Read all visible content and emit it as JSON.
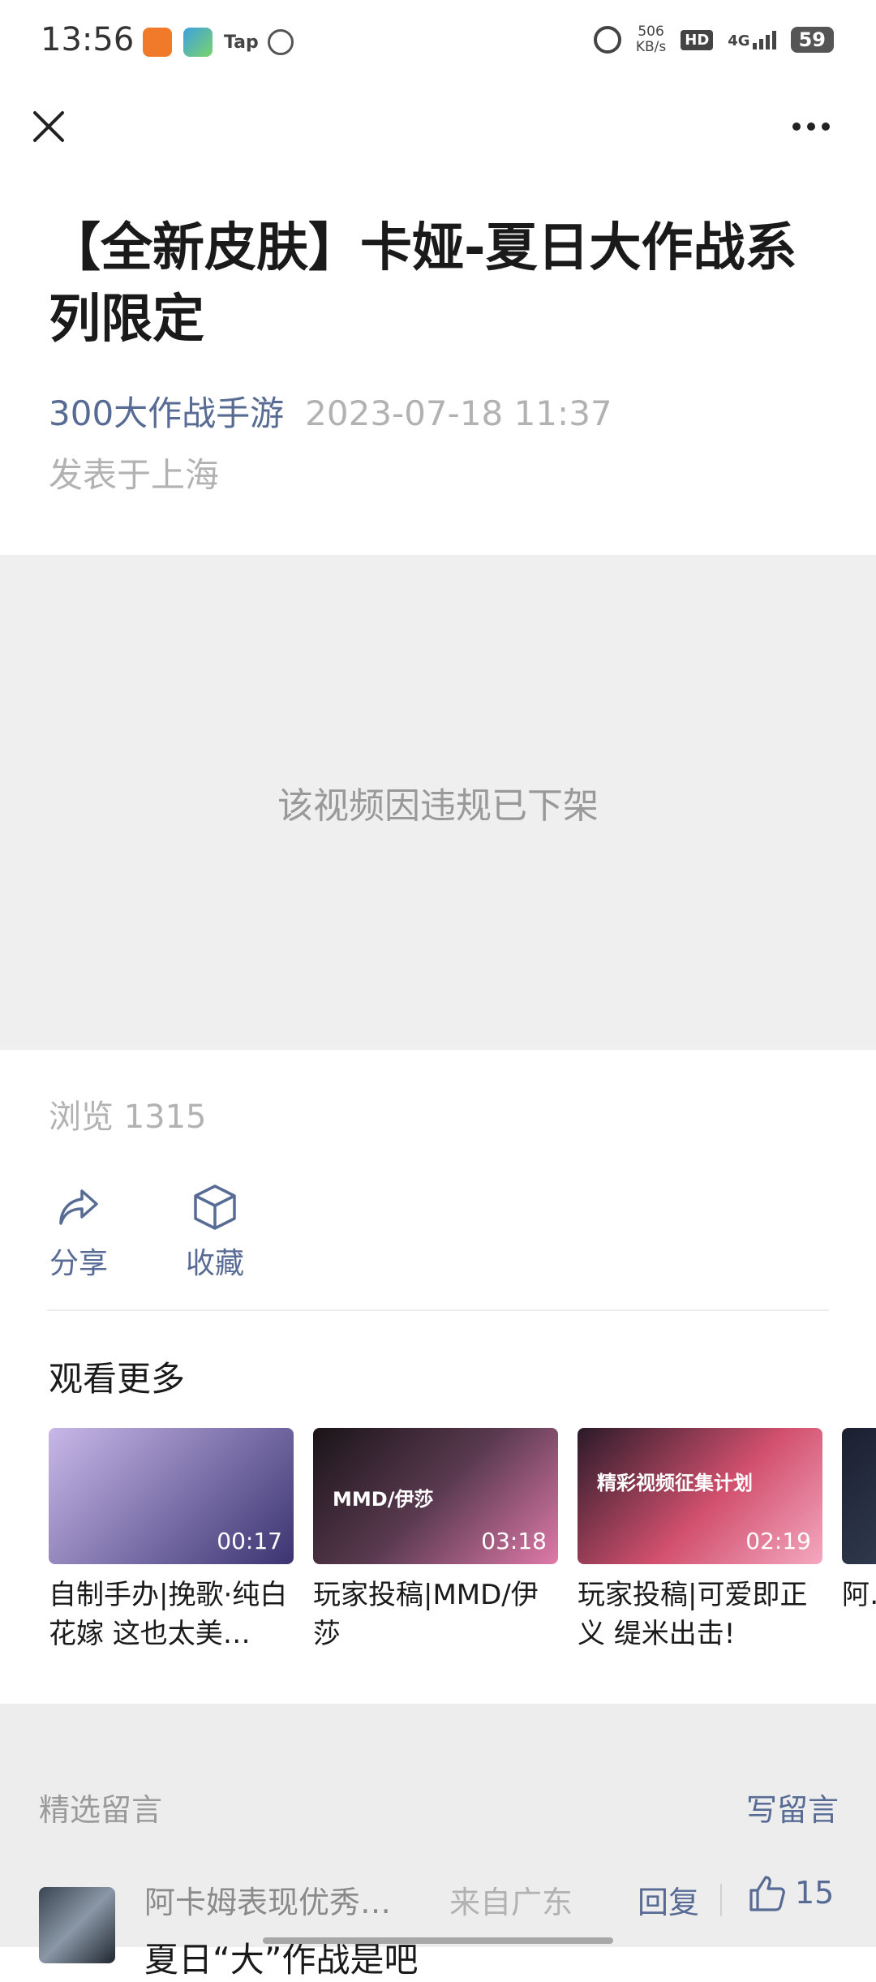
{
  "status_bar": {
    "time": "13:56",
    "app_tap_label": "Tap",
    "net_speed_value": "506",
    "net_speed_unit": "KB/s",
    "hd_label": "HD",
    "signal_label": "4G",
    "battery": "59"
  },
  "icons": {
    "close": "close-icon",
    "more": "more-icon",
    "share": "share-icon",
    "favorite": "cube-icon",
    "like": "thumbs-up-icon"
  },
  "article": {
    "title": "【全新皮肤】卡娅-夏日大作战系列限定",
    "author": "300大作战手游",
    "date": "2023-07-18 11:37",
    "location": "发表于上海"
  },
  "video": {
    "message": "该视频因违规已下架"
  },
  "stats": {
    "views": "浏览 1315"
  },
  "actions": {
    "share": "分享",
    "favorite": "收藏"
  },
  "watch_more": {
    "title": "观看更多",
    "cards": [
      {
        "title": "自制手办|挽歌·纯白花嫁 这也太美…",
        "duration": "00:17",
        "thumb_label": "",
        "color": "#7a6fa8"
      },
      {
        "title": "玩家投稿|MMD/伊莎",
        "duration": "03:18",
        "thumb_label": "MMD/伊莎",
        "color": "#3a2a3a"
      },
      {
        "title": "玩家投稿|可爱即正义 缇米出击!",
        "duration": "02:19",
        "thumb_label": "精彩视频征集计划",
        "color": "#d1506e"
      },
      {
        "title": "阿…我…",
        "duration": "",
        "thumb_label": "",
        "color": "#2a3040"
      }
    ]
  },
  "comments": {
    "header": "精选留言",
    "write": "写留言",
    "first": {
      "name": "阿卡姆表现优秀…",
      "location": "来自广东",
      "reply": "回复",
      "likes": "15",
      "text": "夏日“大”作战是吧"
    }
  }
}
